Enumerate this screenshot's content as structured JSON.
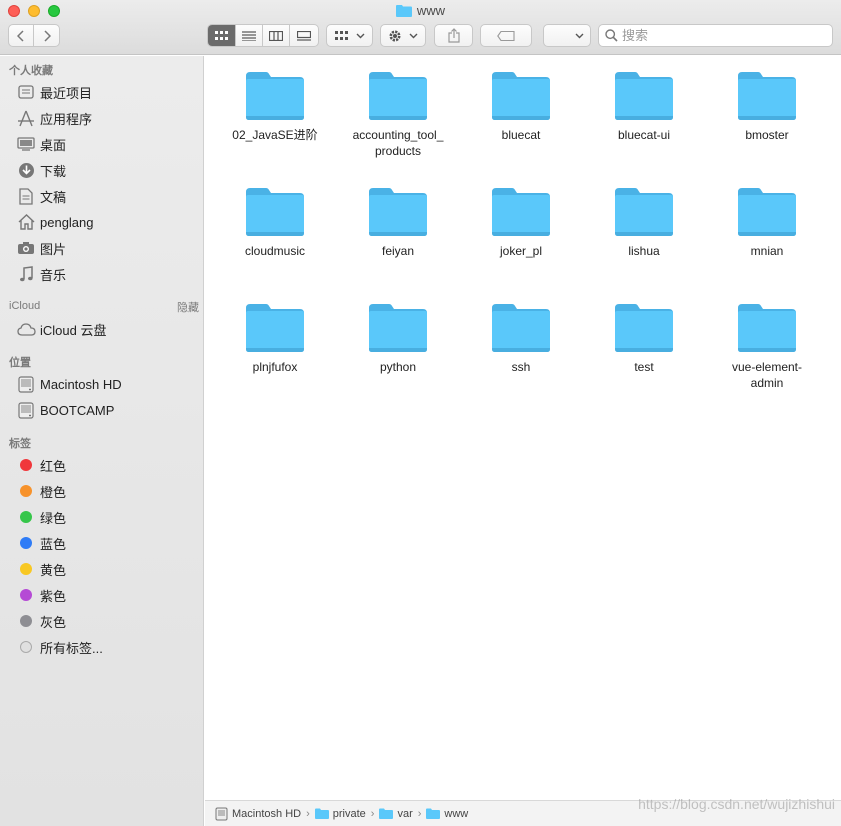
{
  "window": {
    "title": "www"
  },
  "toolbar": {
    "search_placeholder": "搜索"
  },
  "sidebar": {
    "favorites_title": "个人收藏",
    "favorites": [
      {
        "label": "最近项目",
        "icon": "recents-icon"
      },
      {
        "label": "应用程序",
        "icon": "applications-icon"
      },
      {
        "label": "桌面",
        "icon": "desktop-icon"
      },
      {
        "label": "下载",
        "icon": "downloads-icon"
      },
      {
        "label": "文稿",
        "icon": "documents-icon"
      },
      {
        "label": "penglang",
        "icon": "home-icon"
      },
      {
        "label": "图片",
        "icon": "camera-icon"
      },
      {
        "label": "音乐",
        "icon": "music-icon"
      }
    ],
    "icloud_title": "iCloud",
    "icloud_hide": "隐藏",
    "icloud": [
      {
        "label": "iCloud 云盘",
        "icon": "cloud-icon"
      }
    ],
    "locations_title": "位置",
    "locations": [
      {
        "label": "Macintosh HD",
        "icon": "disk-icon"
      },
      {
        "label": "BOOTCAMP",
        "icon": "disk-icon"
      }
    ],
    "tags_title": "标签",
    "tags": [
      {
        "label": "红色",
        "color": "#f0373b"
      },
      {
        "label": "橙色",
        "color": "#f7922b"
      },
      {
        "label": "绿色",
        "color": "#36c64a"
      },
      {
        "label": "蓝色",
        "color": "#2f7cf6"
      },
      {
        "label": "黄色",
        "color": "#f8c823"
      },
      {
        "label": "紫色",
        "color": "#b54ad5"
      },
      {
        "label": "灰色",
        "color": "#8e8e93"
      }
    ],
    "all_tags": "所有标签..."
  },
  "folders": [
    "02_JavaSE进阶",
    "accounting_tool_\nproducts",
    "bluecat",
    "bluecat-ui",
    "bmoster",
    "cloudmusic",
    "feiyan",
    "joker_pl",
    "lishua",
    "mnian",
    "plnjfufox",
    "python",
    "ssh",
    "test",
    "vue-element-\nadmin"
  ],
  "pathbar": [
    "Macintosh HD",
    "private",
    "var",
    "www"
  ],
  "watermark": "https://blog.csdn.net/wujizhishui",
  "colors": {
    "folder": "#5ac8fa",
    "accent": "#6b6b6b"
  }
}
